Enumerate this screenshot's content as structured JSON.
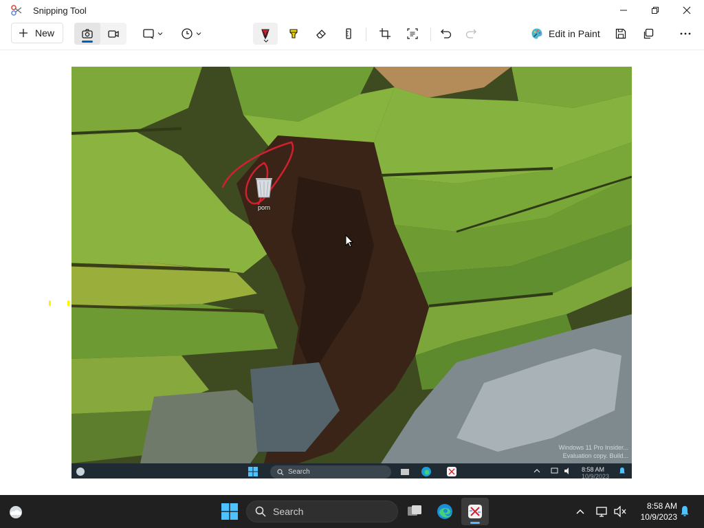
{
  "window": {
    "title": "Snipping Tool",
    "app_icon": "snipping-tool-icon",
    "controls": [
      "minimize-icon",
      "restore-icon",
      "close-icon"
    ]
  },
  "toolbar": {
    "new_label": "New",
    "modes": [
      {
        "name": "screenshot-mode",
        "icon": "camera-icon",
        "active": true
      },
      {
        "name": "video-mode",
        "icon": "video-camera-icon",
        "active": false
      }
    ],
    "snip_shape_icon": "rectangle-snip-icon",
    "delay_icon": "timer-icon",
    "annotation_tools": [
      "ballpoint-pen-icon",
      "highlighter-icon",
      "eraser-icon",
      "ruler-icon"
    ],
    "edit_tools": [
      "crop-icon",
      "text-actions-icon",
      "undo-icon",
      "redo-icon"
    ],
    "edit_in_paint_label": "Edit in Paint",
    "actions": [
      "save-icon",
      "copy-icon",
      "more-icon"
    ],
    "accent": "#005fb8",
    "pen_color": "#d32031",
    "highlighter_color": "#f3d400"
  },
  "capture": {
    "desktop_icon_label": "porn",
    "watermark_line1": "Windows 11 Pro Insider...",
    "watermark_line2": "Evaluation copy. Build...",
    "mini_taskbar": {
      "search_placeholder": "Search",
      "time": "8:58 AM",
      "date": "10/9/2023"
    }
  },
  "taskbar": {
    "search_placeholder": "Search",
    "time": "8:58 AM",
    "date": "10/9/2023",
    "pinned": [
      "start-icon",
      "task-view-icon",
      "edge-icon",
      "snipping-tool-icon"
    ],
    "tray": [
      "chevron-up-icon",
      "network-icon",
      "volume-muted-icon",
      "notification-bell-icon"
    ],
    "background": "#202020"
  }
}
